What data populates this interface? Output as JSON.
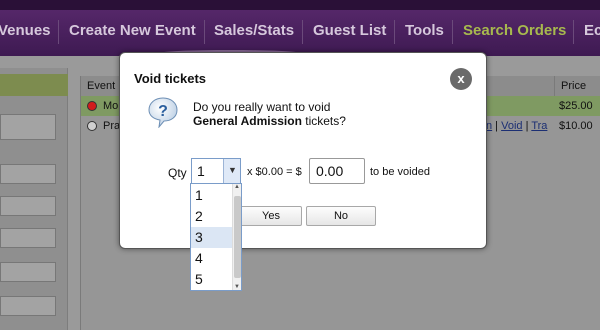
{
  "nav": {
    "items": [
      {
        "label": "Venues",
        "active": false
      },
      {
        "label": "Create New Event",
        "active": false
      },
      {
        "label": "Sales/Stats",
        "active": false
      },
      {
        "label": "Guest List",
        "active": false
      },
      {
        "label": "Tools",
        "active": false
      },
      {
        "label": "Search Orders",
        "active": true
      },
      {
        "label": "Ec",
        "active": false
      }
    ],
    "active_color": "#a7b94e"
  },
  "table": {
    "headers": {
      "event": "Event",
      "price": "Price"
    },
    "rows": [
      {
        "event": "Mo",
        "price": "$25.00",
        "status_color": "#d11c1c"
      },
      {
        "event": "Pra",
        "links": [
          "n",
          "Void",
          "Tra"
        ],
        "price": "$10.00",
        "status_color": "#cfcfcf"
      }
    ]
  },
  "dialog": {
    "title": "Void tickets",
    "close_icon": "close-icon",
    "question_icon": "question-icon",
    "message_line1": "Do you really want to void",
    "message_ticket": "General Admission",
    "message_suffix": " tickets?",
    "qty_label": "Qty",
    "qty_value": "1",
    "multiplier_text": "x $0.00 = $",
    "amount_value": "0.00",
    "voided_text": "to be voided",
    "yes_label": "Yes",
    "no_label": "No"
  },
  "qty_dropdown": {
    "options": [
      "1",
      "2",
      "3",
      "4",
      "5"
    ],
    "highlighted": "3"
  }
}
